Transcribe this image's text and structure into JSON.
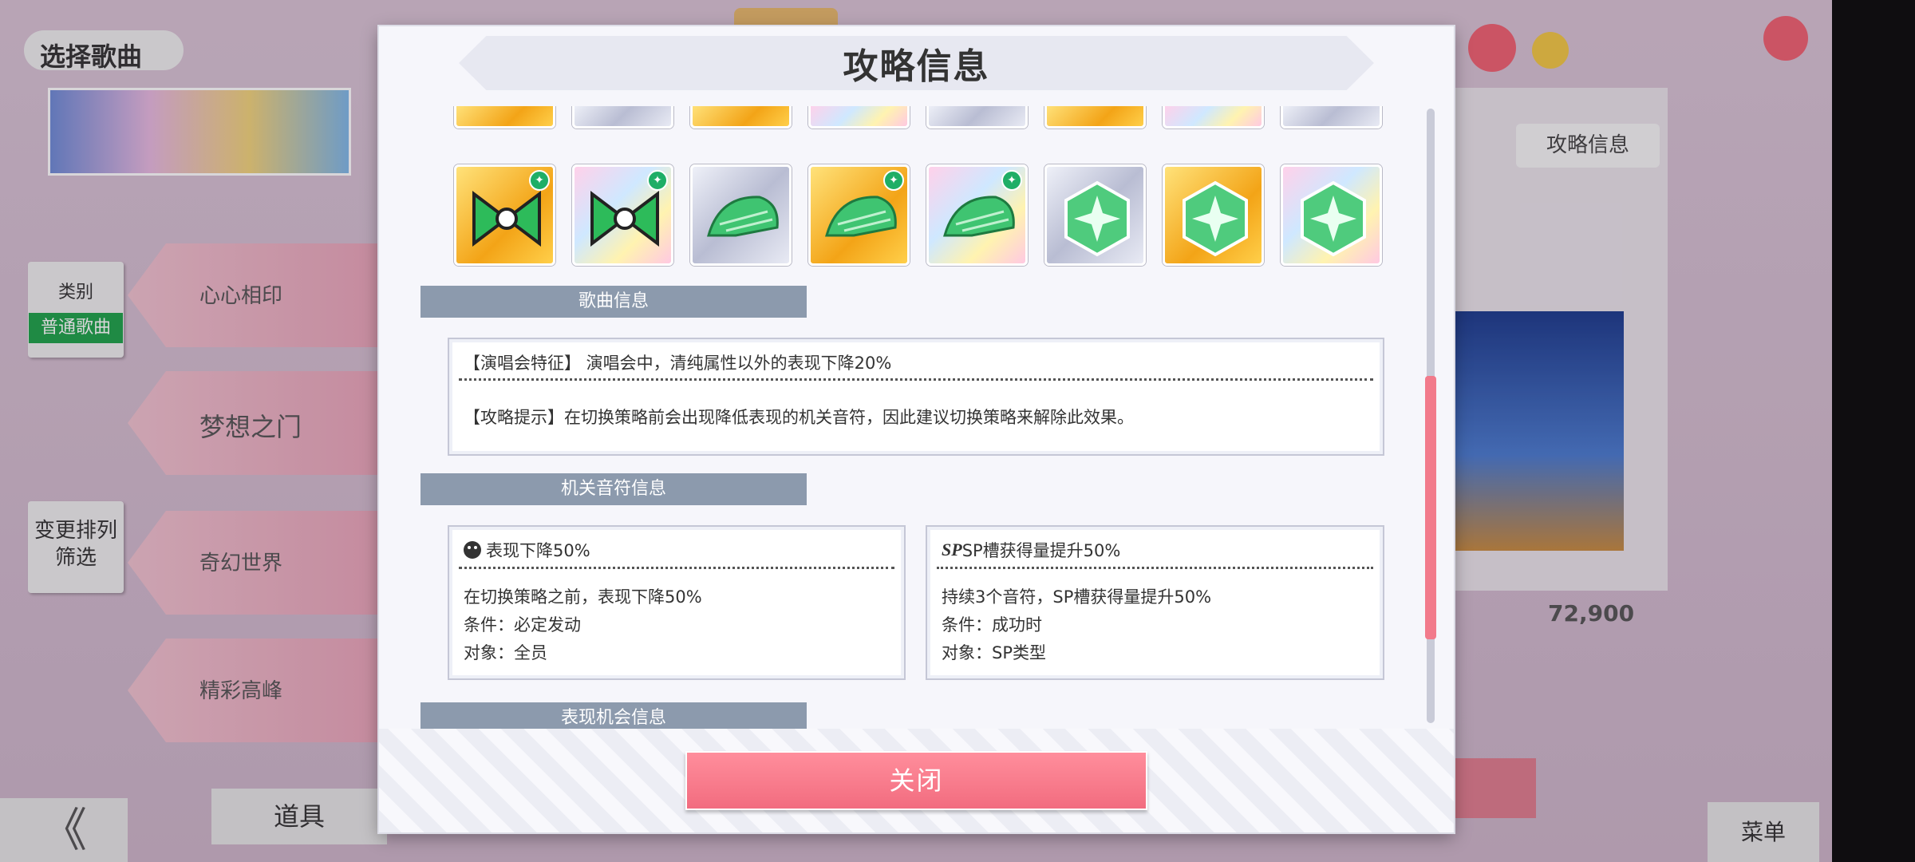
{
  "background": {
    "title": "选择歌曲",
    "side_buttons": [
      "badge",
      "变更排列\n筛选"
    ],
    "side_green": "普通歌曲",
    "rows": [
      "心心相印",
      "梦想之门",
      "奇幻世界",
      "精彩高峰"
    ],
    "back_label": "《",
    "items_label": "道具",
    "strategy_label": "攻略信息",
    "score": "72,900",
    "menu_label": "菜单"
  },
  "modal": {
    "title": "攻略信息",
    "items_top": [
      "gold-pink",
      "silver",
      "gold",
      "rainbow",
      "silver",
      "gold",
      "rainbow",
      "silver"
    ],
    "items": [
      {
        "name": "green-bow-gold",
        "frame": "gold"
      },
      {
        "name": "green-bow-rainbow",
        "frame": "rainbow"
      },
      {
        "name": "green-cap-silver",
        "frame": "silver"
      },
      {
        "name": "green-cap-gold",
        "frame": "gold"
      },
      {
        "name": "green-cap-rainbow",
        "frame": "rainbow"
      },
      {
        "name": "green-gem-silver",
        "frame": "silver"
      },
      {
        "name": "green-gem-gold",
        "frame": "gold"
      },
      {
        "name": "green-gem-rainbow",
        "frame": "rainbow"
      }
    ],
    "song_section": "歌曲信息",
    "song_feature": "【演唱会特征】 演唱会中，清纯属性以外的表现下降20%",
    "song_tip": "【攻略提示】在切换策略前会出现降低表现的机关音符，因此建议切换策略来解除此效果。",
    "gimmick_section": "机关音符信息",
    "gimmick_left": {
      "head": "表现下降50%",
      "desc": "在切换策略之前，表现下降50%",
      "condition": "条件：必定发动",
      "target": "对象：全员"
    },
    "gimmick_right": {
      "mark": "SP",
      "head": "SP槽获得量提升50%",
      "desc": "持续3个音符，SP槽获得量提升50%",
      "condition": "条件：成功时",
      "target": "对象：SP类型"
    },
    "chance_section": "表现机会信息",
    "close_label": "关闭"
  },
  "colors": {
    "accent_pink": "#f26c7f",
    "section_bar": "#8c9aad",
    "badge_green": "#1fae66"
  }
}
